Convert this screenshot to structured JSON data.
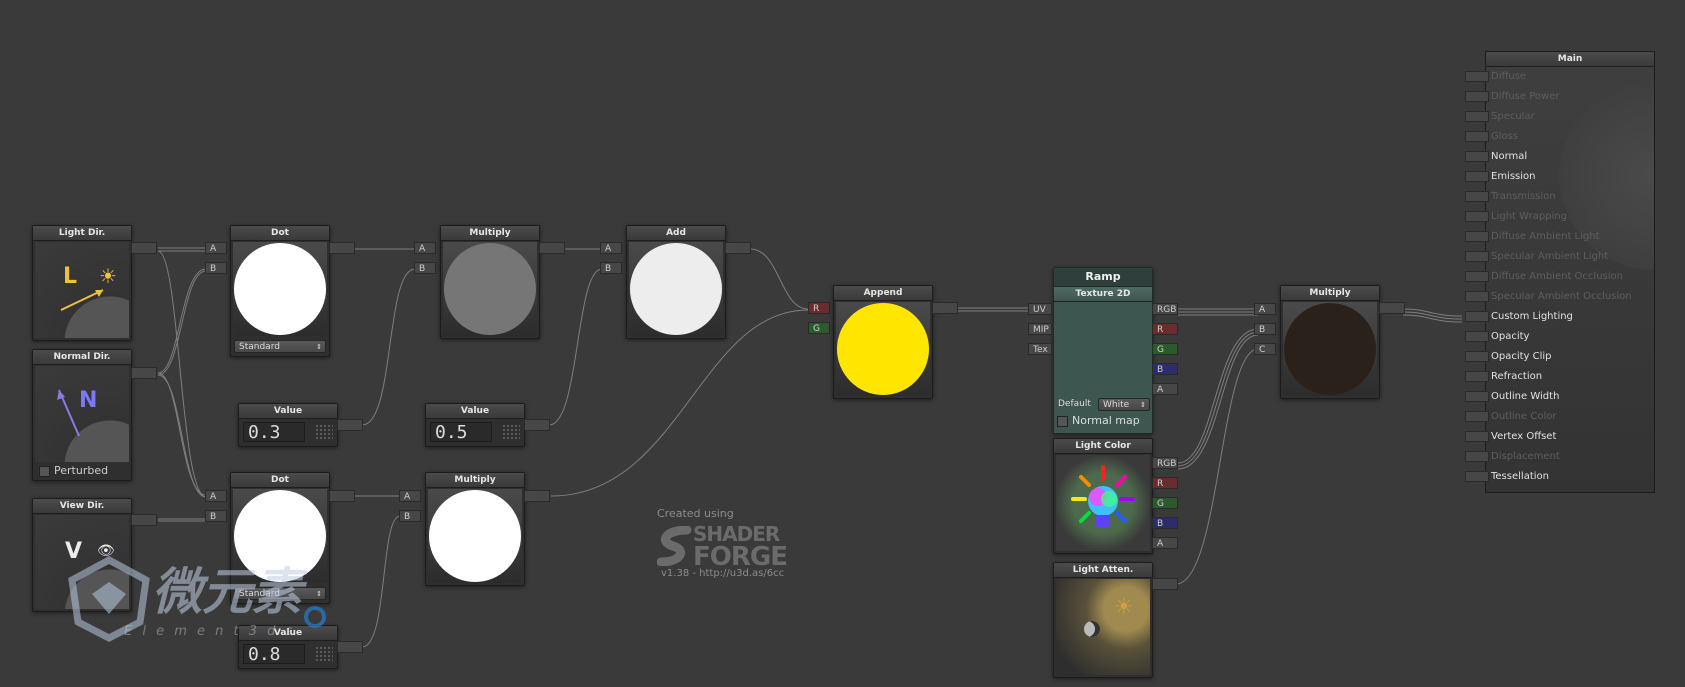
{
  "nodes": {
    "light_dir": {
      "title": "Light Dir.",
      "glyph": "L",
      "icon": "sun-icon"
    },
    "normal_dir": {
      "title": "Normal Dir.",
      "glyph": "N",
      "checkbox_label": "Perturbed"
    },
    "view_dir": {
      "title": "View Dir.",
      "glyph": "V",
      "icon": "eye-icon"
    },
    "dot1": {
      "title": "Dot",
      "in_a": "A",
      "in_b": "B",
      "mode": "Standard"
    },
    "dot2": {
      "title": "Dot",
      "in_a": "A",
      "in_b": "B",
      "mode": "Standard"
    },
    "value1": {
      "title": "Value",
      "value": "0.3"
    },
    "value2": {
      "title": "Value",
      "value": "0.5"
    },
    "value3": {
      "title": "Value",
      "value": "0.8"
    },
    "multiply1": {
      "title": "Multiply",
      "in_a": "A",
      "in_b": "B"
    },
    "multiply2": {
      "title": "Multiply",
      "in_a": "A",
      "in_b": "B"
    },
    "add": {
      "title": "Add",
      "in_a": "A",
      "in_b": "B"
    },
    "append": {
      "title": "Append",
      "in_r": "R",
      "in_g": "G"
    },
    "texture": {
      "header": "Ramp",
      "title": "Texture 2D",
      "inputs": [
        "UV",
        "MIP",
        "Tex"
      ],
      "outputs": [
        "RGB",
        "R",
        "G",
        "B",
        "A"
      ],
      "default_label": "Default",
      "default_value": "White",
      "normal_map_label": "Normal map"
    },
    "light_color": {
      "title": "Light Color",
      "outputs": [
        "RGB",
        "R",
        "G",
        "B",
        "A"
      ]
    },
    "light_atten": {
      "title": "Light Atten."
    },
    "multiply3": {
      "title": "Multiply",
      "in_a": "A",
      "in_b": "B",
      "in_c": "C"
    }
  },
  "main": {
    "title": "Main",
    "inputs": [
      {
        "label": "Diffuse",
        "active": false
      },
      {
        "label": "Diffuse Power",
        "active": false
      },
      {
        "label": "Specular",
        "active": false
      },
      {
        "label": "Gloss",
        "active": false
      },
      {
        "label": "Normal",
        "active": true
      },
      {
        "label": "Emission",
        "active": true
      },
      {
        "label": "Transmission",
        "active": false
      },
      {
        "label": "Light Wrapping",
        "active": false
      },
      {
        "label": "Diffuse Ambient Light",
        "active": false
      },
      {
        "label": "Specular Ambient Light",
        "active": false
      },
      {
        "label": "Diffuse Ambient Occlusion",
        "active": false
      },
      {
        "label": "Specular Ambient Occlusion",
        "active": false
      },
      {
        "label": "Custom Lighting",
        "active": true
      },
      {
        "label": "Opacity",
        "active": true
      },
      {
        "label": "Opacity Clip",
        "active": true
      },
      {
        "label": "Refraction",
        "active": true
      },
      {
        "label": "Outline Width",
        "active": true
      },
      {
        "label": "Outline Color",
        "active": false
      },
      {
        "label": "Vertex Offset",
        "active": true
      },
      {
        "label": "Displacement",
        "active": false
      },
      {
        "label": "Tessellation",
        "active": true
      }
    ]
  },
  "credits": {
    "created_using": "Created using",
    "logo_line1": "SHADER",
    "logo_line2": "FORGE",
    "version": "v1.38 - http://u3d.as/6cc"
  },
  "watermark": {
    "chars": "微元素",
    "subtitle": "E l e m e n t 3 d s"
  },
  "colors": {
    "canvas": "#3a3a3a",
    "white_preview": "#ffffff",
    "gray_preview": "#767676",
    "light_preview": "#ededed",
    "yellow_preview": "#ffe600",
    "dark_preview": "#2a211b",
    "texture_body": "#3e5650"
  }
}
